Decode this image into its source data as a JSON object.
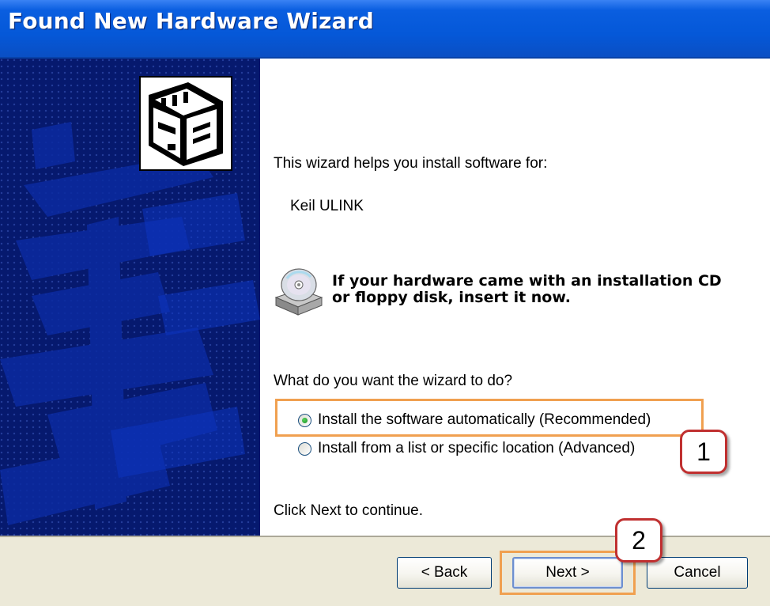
{
  "window": {
    "title": "Found New Hardware Wizard"
  },
  "intro": {
    "text": "This wizard helps you install software for:",
    "device_name": "Keil ULINK"
  },
  "cd_notice": {
    "line1": "If your hardware came with an installation CD",
    "line2": "or floppy disk, insert it now."
  },
  "question": "What do you want the wizard to do?",
  "options": [
    {
      "label": "Install the software automatically (Recommended)",
      "selected": true
    },
    {
      "label": "Install from a list or specific location (Advanced)",
      "selected": false
    }
  ],
  "continue_text": "Click Next to continue.",
  "buttons": {
    "back": "< Back",
    "next": "Next >",
    "cancel": "Cancel"
  },
  "annotations": {
    "callout1": "1",
    "callout2": "2"
  },
  "colors": {
    "title_bar": "#0558d8",
    "side_panel": "#06196e",
    "highlight": "#f0a050",
    "callout_border": "#c03030",
    "bottom_bar": "#ece9d8"
  },
  "icons": {
    "hardware": "hardware-board-icon",
    "cd": "cd-drive-icon"
  }
}
